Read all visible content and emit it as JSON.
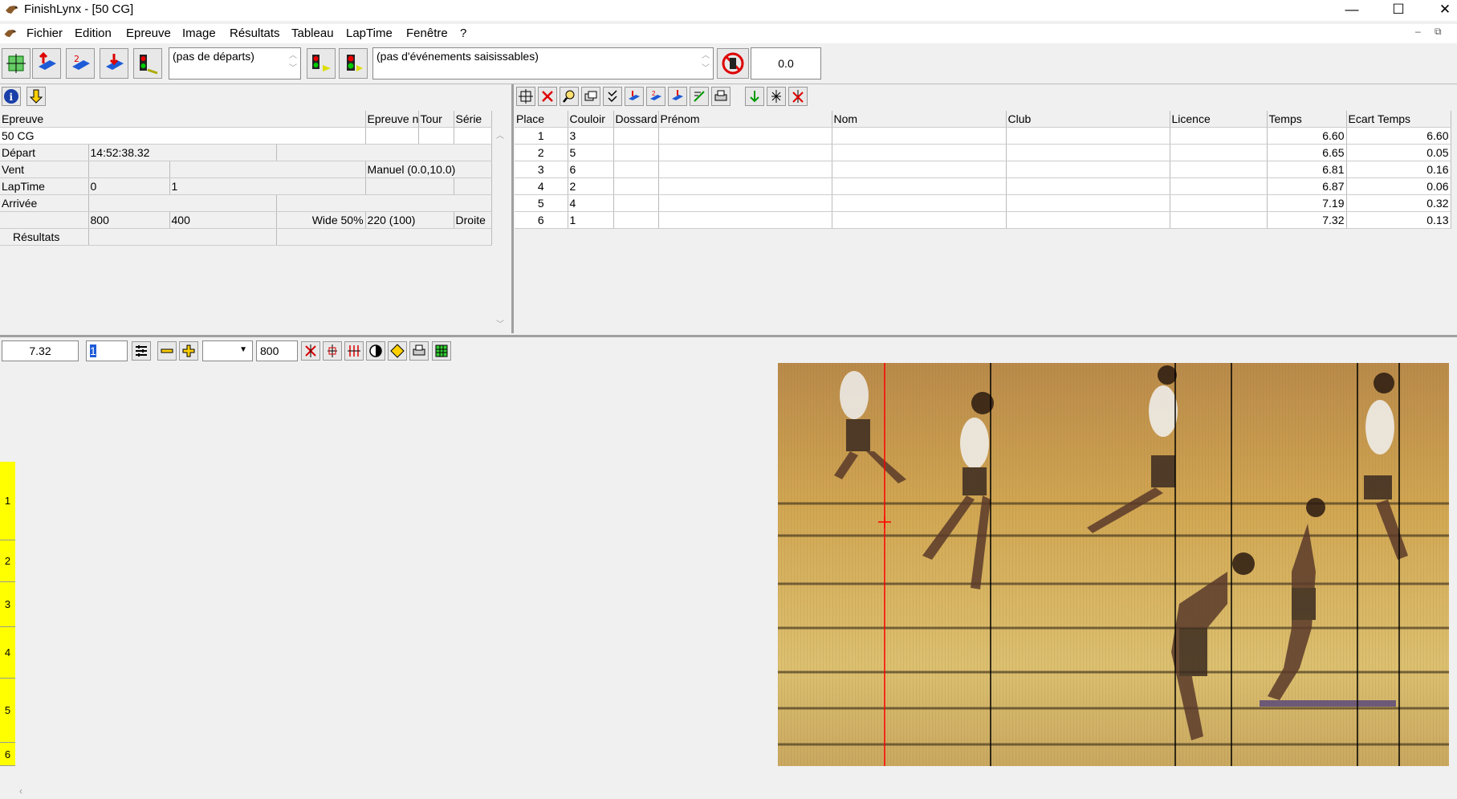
{
  "window": {
    "title": "FinishLynx - [50 CG]",
    "minimize": "—",
    "maximize": "☐",
    "close": "✕"
  },
  "menu": [
    "Fichier",
    "Edition",
    "Epreuve",
    "Image",
    "Résultats",
    "Tableau",
    "LapTime",
    "Fenêtre",
    "?"
  ],
  "toolbar": {
    "departs_combo": "(pas de départs)",
    "events_combo": "(pas d'événements saisissables)",
    "timer_value": "0.0"
  },
  "event_panel": {
    "headers": [
      "Epreuve",
      "Epreuve n",
      "Tour",
      "Série"
    ],
    "event_name": "50 CG",
    "rows": [
      {
        "label": "Départ",
        "cells": [
          "14:52:38.32",
          "",
          ""
        ]
      },
      {
        "label": "Vent",
        "cells": [
          "",
          "",
          "Manuel (0.0,10.0)"
        ]
      },
      {
        "label": "LapTime",
        "cells": [
          "0",
          "1",
          "",
          ""
        ]
      },
      {
        "label": "Arrivée",
        "cells": [
          "",
          "",
          ""
        ]
      },
      {
        "label": "",
        "cells": [
          "800",
          "400",
          "Wide 50%",
          "220  (100)",
          "Droite"
        ]
      },
      {
        "label": "Résultats",
        "cells": [
          "",
          ""
        ]
      }
    ]
  },
  "results": {
    "columns": [
      "Place",
      "Couloir",
      "Dossard",
      "Prénom",
      "Nom",
      "Club",
      "Licence",
      "Temps",
      "Ecart Temps"
    ],
    "rows": [
      [
        "1",
        "3",
        "",
        "",
        "",
        "",
        "",
        "6.60",
        "6.60"
      ],
      [
        "2",
        "5",
        "",
        "",
        "",
        "",
        "",
        "6.65",
        "0.05"
      ],
      [
        "3",
        "6",
        "",
        "",
        "",
        "",
        "",
        "6.81",
        "0.16"
      ],
      [
        "4",
        "2",
        "",
        "",
        "",
        "",
        "",
        "6.87",
        "0.06"
      ],
      [
        "5",
        "4",
        "",
        "",
        "",
        "",
        "",
        "7.19",
        "0.32"
      ],
      [
        "6",
        "1",
        "",
        "",
        "",
        "",
        "",
        "7.32",
        "0.13"
      ]
    ]
  },
  "image_toolbar": {
    "time_value": "7.32",
    "cursor_value": "1",
    "zoom_value": "800"
  },
  "lanes": [
    "1",
    "2",
    "3",
    "4",
    "5",
    "6"
  ],
  "colors": {
    "lane_active": "#ff0000",
    "lane": "#ffff00",
    "cursor_line": "#ff0000",
    "time_line": "#000000"
  }
}
